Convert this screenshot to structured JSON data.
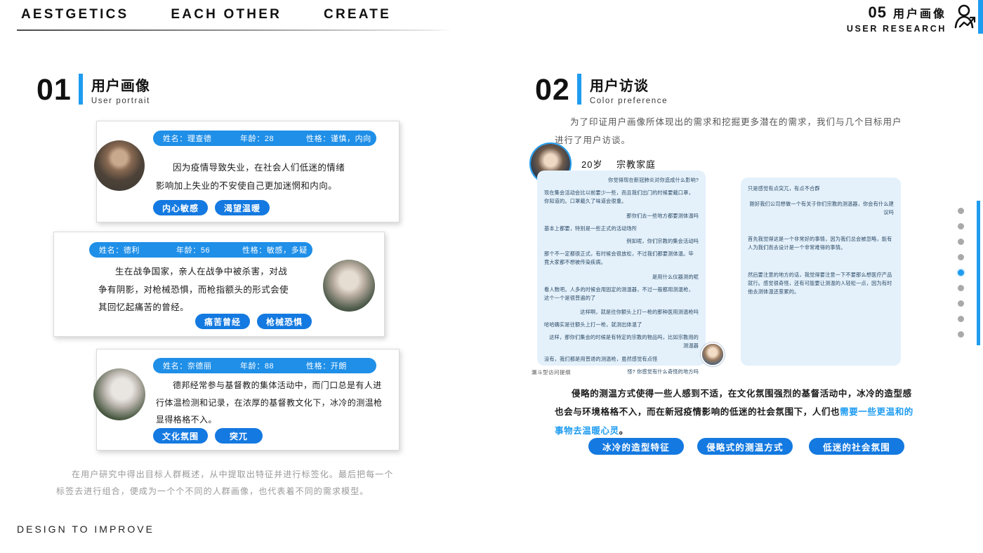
{
  "header": {
    "nav": [
      "AESTGETICS",
      "EACH OTHER",
      "CREATE"
    ],
    "page_number": "05",
    "title_cn": "用户画像",
    "title_en": "USER RESEARCH",
    "icon": "person-chart-icon",
    "accent_color": "#1f9cf0"
  },
  "sections": [
    {
      "number": "01",
      "cn": "用户画像",
      "en": "User portrait"
    },
    {
      "number": "02",
      "cn": "用户访谈",
      "en": "Color preference"
    }
  ],
  "personas": [
    {
      "avatar": "photo-man-beard",
      "name_label": "姓名：",
      "name_value": "理查德",
      "age_label": "年龄：",
      "age_value": "28",
      "trait_label": "性格：",
      "trait_value": "谨慎，内向",
      "desc_line1": "因为疫情导致失业，在社会人们低迷的情绪",
      "desc_line2": "影响加上失业的不安使自己更加迷惘和内向。",
      "tags": [
        "内心敏感",
        "渴望温暖"
      ]
    },
    {
      "avatar": "photo-elderly-man",
      "name_label": "姓名：",
      "name_value": "德利",
      "age_label": "年龄：",
      "age_value": "56",
      "trait_label": "性格：",
      "trait_value": "敏感，多疑",
      "desc_line1": "生在战争国家，亲人在战争中被杀害，对战",
      "desc_line2": "争有阴影，对枪械恐惧，而枪指额头的形式会使",
      "desc_line3": "其回忆起痛苦的曾经。",
      "tags": [
        "痛苦曾经",
        "枪械恐惧"
      ]
    },
    {
      "avatar": "photo-elderly-woman",
      "name_label": "姓名：",
      "name_value": "奈德丽",
      "age_label": "年龄：",
      "age_value": "88",
      "trait_label": "性格：",
      "trait_value": "开朗",
      "desc_line1": "德邦经常参与基督教的集体活动中，而门口总是有人进",
      "desc_line2": "行体温检测和记录，在浓厚的基督教文化下，冰冷的测温枪",
      "desc_line3": "显得格格不入。",
      "tags": [
        "文化氛围",
        "突兀"
      ]
    }
  ],
  "left_caption": {
    "line1": "在用户研究中得出目标人群概述，从中提取出特征并进行标签化。最后把每一个",
    "line2": "标签去进行组合，便成为一个个不同的人群画像，也代表着不同的需求模型。"
  },
  "interview": {
    "intro_line1": "为了印证用户画像所体现出的需求和挖掘更多潜在的需求，我们与几个目标用户",
    "intro_line2": "进行了用户访谈。",
    "subject_avatar": "photo-young-man",
    "subject_age": "20岁",
    "subject_tag": "宗教家庭",
    "figure_caption": "漏斗型访问提纲",
    "transcript_left": [
      {
        "role": "q",
        "text": "你觉得现在新冠肺炎对你造成什么影响?"
      },
      {
        "role": "a",
        "text": "现在集会活动会比以前要少一些，而且我们出门的时候要戴口罩，你知道的。口罩戴久了味道会很重。"
      },
      {
        "role": "q",
        "text": "那你们去一些地方都要测体温吗"
      },
      {
        "role": "a",
        "text": "基本上都要，特别是一些正式的活动场所"
      },
      {
        "role": "q",
        "text": "例如呢，你们宗教的集会活动吗"
      },
      {
        "role": "a",
        "text": "那个不一定都很正式，有时候会很放松，不过我们都要测体温。毕竟大家都不想被传染疾病。"
      },
      {
        "role": "q",
        "text": "是用什么仪器测的呢"
      },
      {
        "role": "a",
        "text": "看人数吧。人多的时候会用固定的测温器，不过一般都用测温枪，这个一个是很普遍的了"
      },
      {
        "role": "q",
        "text": "这样啊，就是往你额头上打一枪的那种医用测温枪吗"
      },
      {
        "role": "a",
        "text": "哈哈确实是往额头上打一枪，就测出体温了"
      },
      {
        "role": "q",
        "text": "这样，那你们集会的时候是有特定的宗教的物品吗，比如宗教用的测温器"
      },
      {
        "role": "a",
        "text": "没有，我们都是用普通的测温枪，虽然感觉有点怪"
      },
      {
        "role": "q",
        "text": "怪? 你感觉有什么奇怪的地方吗"
      }
    ],
    "transcript_right": [
      {
        "role": "a",
        "text": "只是感觉有点突兀，有点不合群"
      },
      {
        "role": "q",
        "text": "刚好我们公司想做一个有关于你们宗教的测温器，你会有什么建议吗"
      },
      {
        "role": "a",
        "text": "首先我觉得这是一个非常好的事情，因为我们总会被忽略，能有人为我们而去设计是一个非常难得的事情。"
      },
      {
        "role": "a",
        "text": "然后要注意的地方的话，我觉得要注意一下不要那么想医疗产品就行。感觉很奇怪，还有可能要让测温的人轻松一点，因为有时他去测体温还蛮累的。"
      }
    ],
    "summary": {
      "line1": "侵略的测温方式使得一些人感到不适，在文化氛围强烈的基督活动中，冰冷的造型感",
      "line2_plain": "也会与环境格格不入，而在新冠疫情影响的低迷的社会氛围下，人们也",
      "line2_highlight": "需要一些更温和的",
      "line3_highlight": "事物去温暖心灵",
      "line3_plain": "。"
    },
    "tags": [
      "冰冷的造型特征",
      "侵略式的测温方式",
      "低迷的社会氛围"
    ]
  },
  "pagination": {
    "total": 9,
    "active_index": 5
  },
  "footer": "DESIGN TO IMPROVE"
}
